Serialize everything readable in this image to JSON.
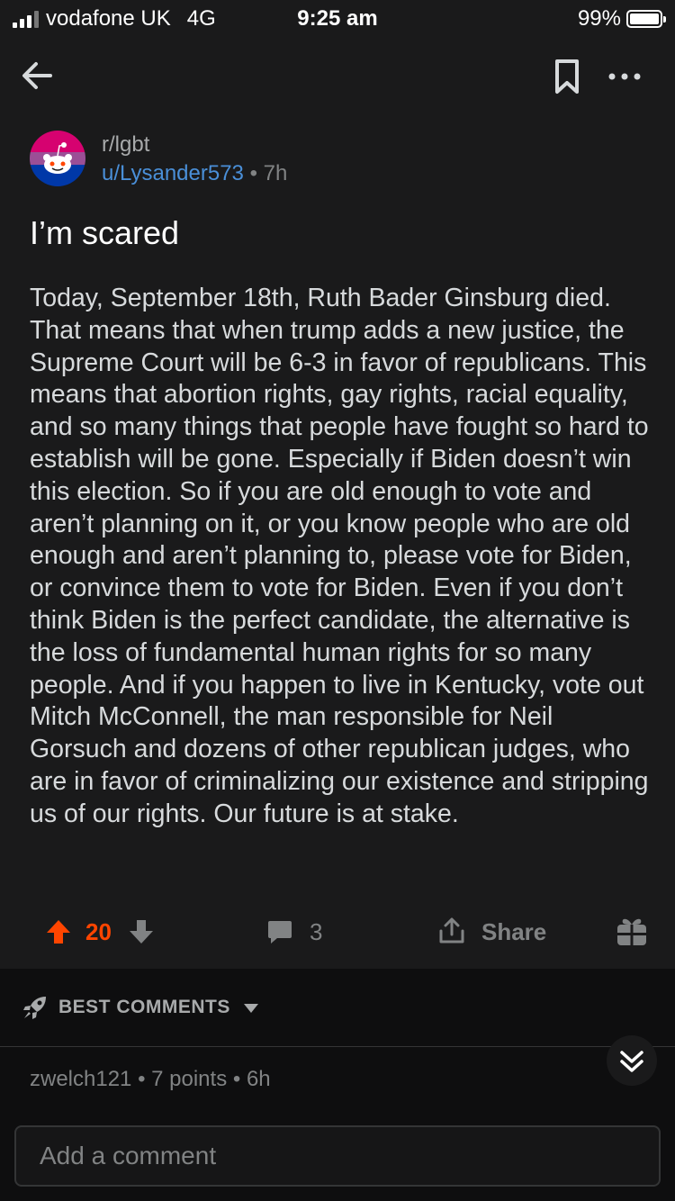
{
  "status_bar": {
    "carrier": "vodafone UK",
    "network": "4G",
    "time": "9:25 am",
    "battery": "99%"
  },
  "post": {
    "subreddit": "r/lgbt",
    "author": "u/Lysander573",
    "separator": "•",
    "age": "7h",
    "title": "I’m scared",
    "body": "Today, September 18th, Ruth Bader Ginsburg died. That means that when trump adds a new justice, the Supreme Court will be 6-3 in favor of republicans. This means that abortion rights, gay rights, racial equality, and so many things that people have fought so hard to establish will be gone. Especially if Biden doesn’t win this election. So if you are old enough to vote and aren’t planning on it, or you know people who are old enough and aren’t planning to, please vote for Biden, or convince them to vote for Biden. Even if you don’t think Biden is the perfect candidate, the alternative is the loss of fundamental human rights for so many people. And if you happen to live in Kentucky, vote out Mitch McConnell, the man responsible for Neil Gorsuch and dozens of other republican judges, who are in favor of criminalizing our existence and stripping us of our rights. Our future is at stake.",
    "votes": "20",
    "comments": "3",
    "share_label": "Share"
  },
  "comments": {
    "sort_label": "BEST COMMENTS",
    "first_comment_meta": "zwelch121 • 7 points • 6h"
  },
  "composer": {
    "placeholder": "Add a comment"
  },
  "icons": {
    "back": "back-arrow-icon",
    "bookmark": "bookmark-icon",
    "more": "more-icon",
    "upvote": "upvote-icon",
    "downvote": "downvote-icon",
    "comment": "comment-icon",
    "share": "share-icon",
    "award": "award-icon",
    "sort": "rocket-icon",
    "collapse": "chevron-double-down-icon"
  },
  "colors": {
    "upvote": "#ff4500",
    "author_link": "#4a8fd8",
    "background": "#1a1a1b"
  }
}
